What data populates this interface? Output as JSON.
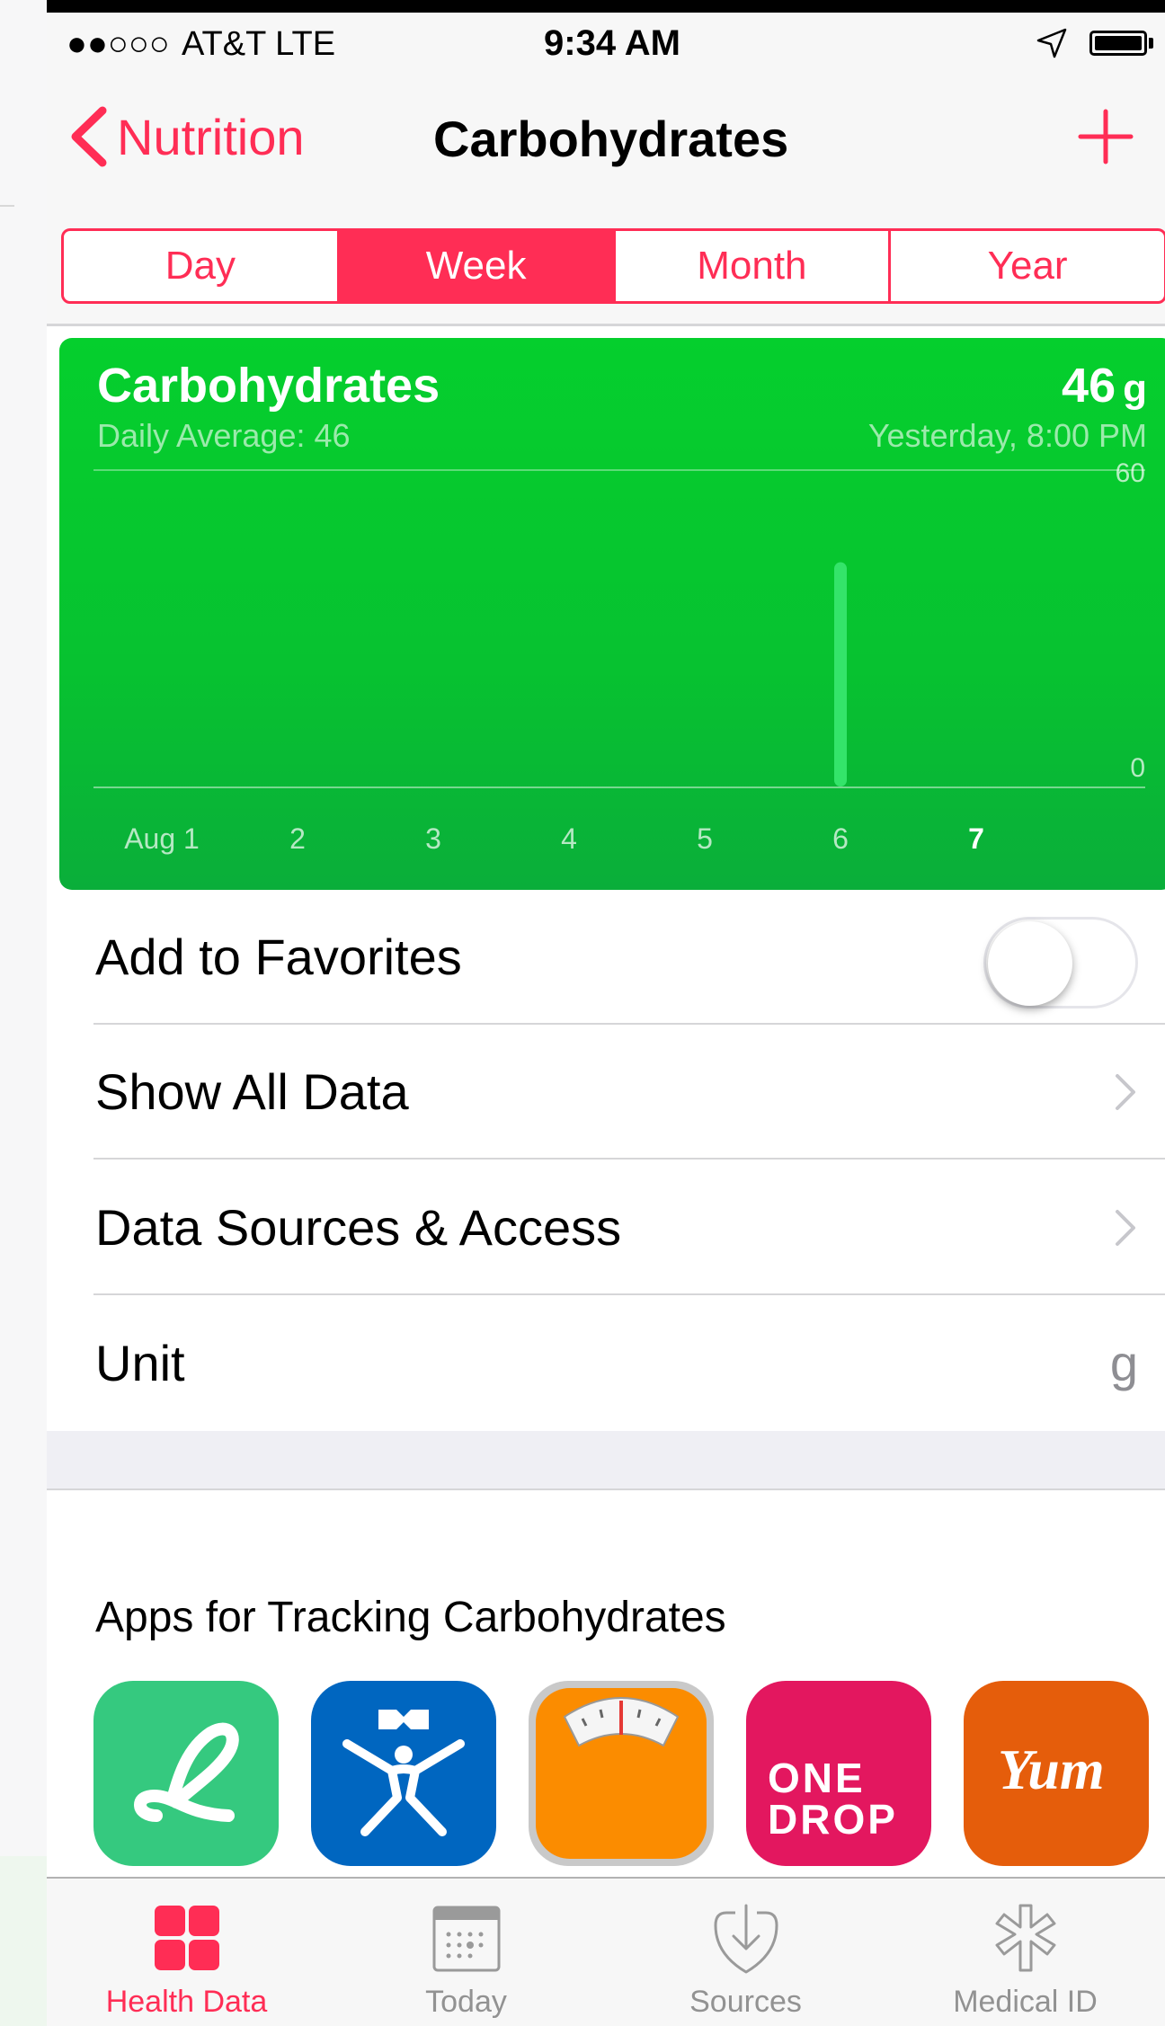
{
  "status_bar": {
    "signal": "●●○○○",
    "carrier": "AT&T  LTE",
    "time": "9:34 AM"
  },
  "nav": {
    "back_label": "Nutrition",
    "title": "Carbohydrates",
    "add_icon": "plus-icon"
  },
  "segments": [
    {
      "label": "Day",
      "active": false
    },
    {
      "label": "Week",
      "active": true
    },
    {
      "label": "Month",
      "active": false
    },
    {
      "label": "Year",
      "active": false
    }
  ],
  "chart": {
    "title": "Carbohydrates",
    "subtitle": "Daily Average: 46",
    "value": "46",
    "unit": "g",
    "time": "Yesterday, 8:00 PM"
  },
  "chart_data": {
    "type": "bar",
    "title": "Carbohydrates",
    "categories": [
      "Aug 1",
      "2",
      "3",
      "4",
      "5",
      "6",
      "7"
    ],
    "values": [
      0,
      0,
      0,
      0,
      0,
      46,
      0
    ],
    "ylim": [
      0,
      60
    ],
    "y_ticks": [
      "60",
      "0"
    ],
    "highlight_category": "7",
    "colors": {
      "background": "#07c230",
      "bar": "#34e46a"
    }
  },
  "rows": {
    "favorites_label": "Add to Favorites",
    "favorites_on": false,
    "show_all_label": "Show All Data",
    "sources_label": "Data Sources & Access",
    "unit_label": "Unit",
    "unit_value": "g"
  },
  "apps": {
    "heading": "Apps for Tracking Carbohydrates",
    "items": [
      {
        "icon": "lifesum-app-icon",
        "color": "#35c97f"
      },
      {
        "icon": "myfitnesspal-app-icon",
        "color": "#0066c0"
      },
      {
        "icon": "scale-app-icon",
        "color": "#fb8c00"
      },
      {
        "icon": "one-drop-app-icon",
        "text": "ONE DROP",
        "color": "#e3175f"
      },
      {
        "icon": "yum-app-icon",
        "text": "Yum",
        "color": "#e55d0b"
      }
    ]
  },
  "tabs": [
    {
      "label": "Health Data",
      "icon": "health-data-icon",
      "active": true
    },
    {
      "label": "Today",
      "icon": "today-icon",
      "active": false
    },
    {
      "label": "Sources",
      "icon": "sources-icon",
      "active": false
    },
    {
      "label": "Medical ID",
      "icon": "medical-id-icon",
      "active": false
    }
  ],
  "colors": {
    "accent": "#ff2d55",
    "inactive_tab": "#929292",
    "chart_green": "#07c230"
  }
}
